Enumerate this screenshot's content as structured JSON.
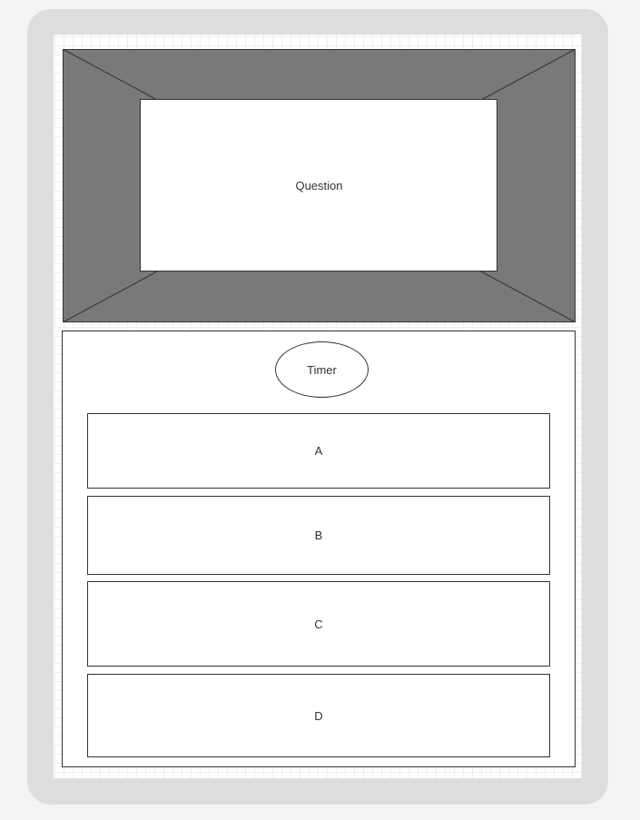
{
  "question": {
    "label": "Question"
  },
  "timer": {
    "label": "Timer"
  },
  "options": [
    {
      "label": "A"
    },
    {
      "label": "B"
    },
    {
      "label": "C"
    },
    {
      "label": "D"
    }
  ],
  "colors": {
    "page_background": "#f4f4f4",
    "device_frame": "#dddddd",
    "panel_fill": "#797979",
    "stroke": "#333333",
    "text": "#333333"
  }
}
